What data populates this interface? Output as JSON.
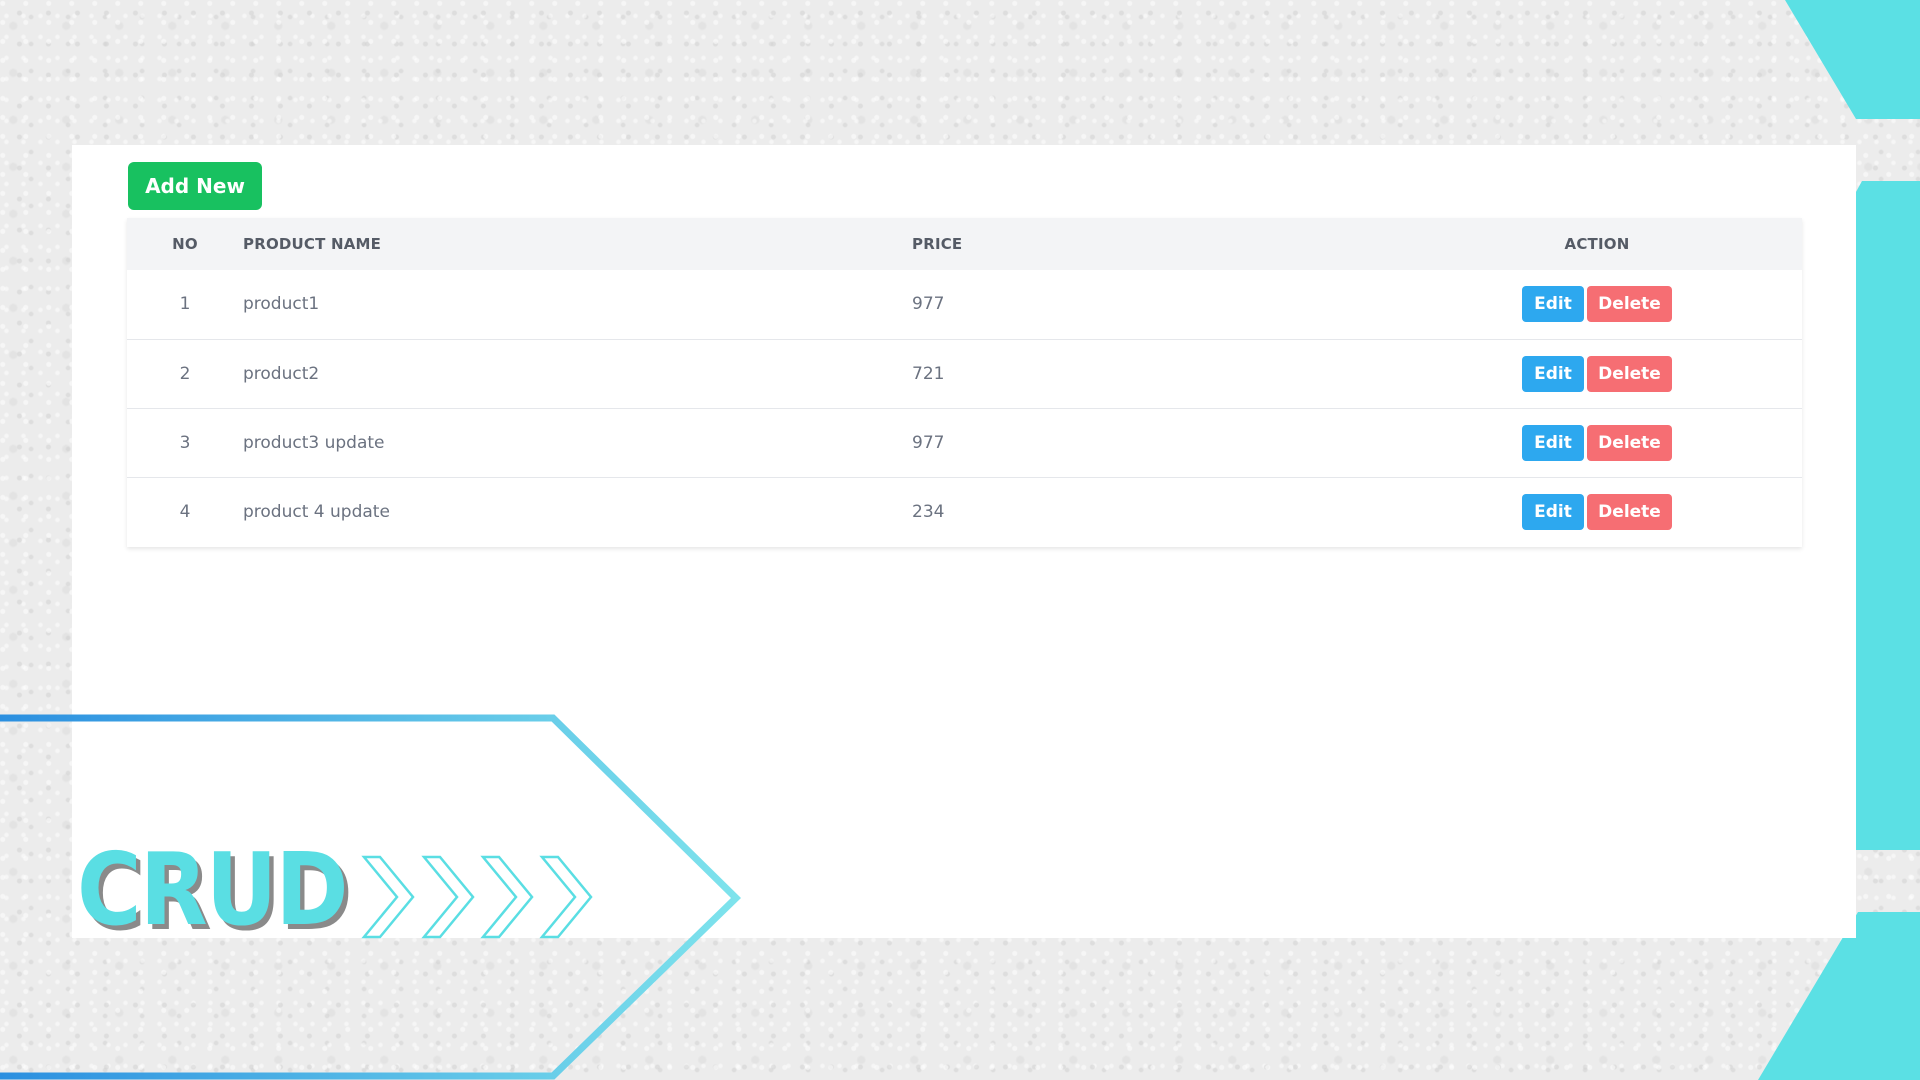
{
  "toolbar": {
    "add_new_label": "Add New"
  },
  "table": {
    "headers": {
      "no": "NO",
      "product_name": "PRODUCT NAME",
      "price": "PRICE",
      "action": "ACTION"
    },
    "rows": [
      {
        "no": "1",
        "name": "product1",
        "price": "977",
        "edit_label": "Edit",
        "delete_label": "Delete"
      },
      {
        "no": "2",
        "name": "product2",
        "price": "721",
        "edit_label": "Edit",
        "delete_label": "Delete"
      },
      {
        "no": "3",
        "name": "product3 update",
        "price": "977",
        "edit_label": "Edit",
        "delete_label": "Delete"
      },
      {
        "no": "4",
        "name": "product 4 update",
        "price": "234",
        "edit_label": "Edit",
        "delete_label": "Delete"
      }
    ]
  },
  "banner": {
    "title": "CRUD"
  },
  "colors": {
    "add_button": "#18c160",
    "edit_button": "#2da8ef",
    "delete_button": "#f66e73",
    "accent_cyan": "#5adee3"
  }
}
